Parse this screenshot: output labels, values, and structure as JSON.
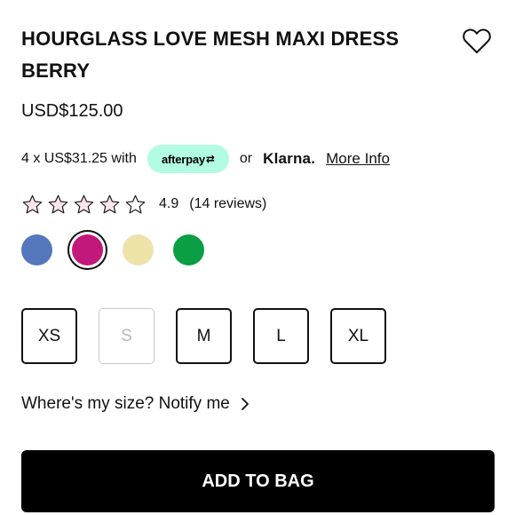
{
  "product": {
    "title": "HOURGLASS LOVE MESH MAXI DRESS BERRY",
    "price": "USD$125.00"
  },
  "payment": {
    "installment_text": "4 x US$31.25 with",
    "afterpay_label": "afterpay",
    "or_text": "or",
    "klarna_label": "Klarna.",
    "more_info_label": "More Info",
    "afterpay_color": "#b2fce4"
  },
  "rating": {
    "value": "4.9",
    "reviews_text": "(14 reviews)",
    "star_count": 5,
    "star_fill_color": "#fde4ee"
  },
  "colors": [
    {
      "name": "blue",
      "hex": "#5577bb",
      "selected": false
    },
    {
      "name": "berry",
      "hex": "#c2187a",
      "selected": true
    },
    {
      "name": "cream",
      "hex": "#ede3a8",
      "selected": false
    },
    {
      "name": "green",
      "hex": "#0a9e45",
      "selected": false
    }
  ],
  "sizes": [
    {
      "label": "XS",
      "available": true
    },
    {
      "label": "S",
      "available": false
    },
    {
      "label": "M",
      "available": true
    },
    {
      "label": "L",
      "available": true
    },
    {
      "label": "XL",
      "available": true
    }
  ],
  "notify": {
    "label": "Where's my size? Notify me"
  },
  "add_to_bag": {
    "label": "ADD TO BAG"
  }
}
